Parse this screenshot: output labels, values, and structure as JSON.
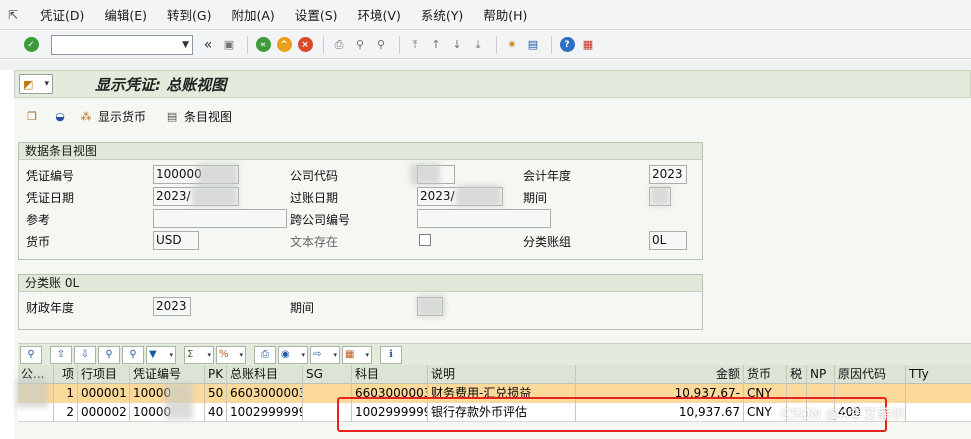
{
  "menu": {
    "items": [
      "凭证(D)",
      "编辑(E)",
      "转到(G)",
      "附加(A)",
      "设置(S)",
      "环境(V)",
      "系统(Y)",
      "帮助(H)"
    ]
  },
  "toolbar": {
    "command_value": ""
  },
  "title": "显示凭证: 总账视图",
  "app_toolbar": {
    "display_currency": "显示货币",
    "item_view": "条目视图"
  },
  "doc_group": {
    "title": "数据条目视图",
    "doc_number_label": "凭证编号",
    "doc_number_value": "100000",
    "company_code_label": "公司代码",
    "company_code_value": "",
    "fiscal_year_label": "会计年度",
    "fiscal_year_value": "2023",
    "doc_date_label": "凭证日期",
    "doc_date_value": "2023/",
    "posting_date_label": "过账日期",
    "posting_date_value": "2023/",
    "period_label": "期间",
    "period_value": "",
    "reference_label": "参考",
    "reference_value": "",
    "cross_company_label": "跨公司编号",
    "cross_company_value": "",
    "currency_label": "货币",
    "currency_value": "USD",
    "text_exists_label": "文本存在",
    "ledger_group_label": "分类账组",
    "ledger_group_value": "0L"
  },
  "ledger_group": {
    "title": "分类账 0L",
    "fiscal_year_label": "财政年度",
    "fiscal_year_value": "2023",
    "period_label": "期间",
    "period_value": ""
  },
  "table": {
    "headers": {
      "company": "公...",
      "item": "项",
      "line_item": "行项目",
      "doc_no": "凭证编号",
      "pk": "PK",
      "gl_account": "总账科目",
      "sg": "SG",
      "account": "科目",
      "text": "说明",
      "amount": "金额",
      "currency": "货币",
      "tax": "税",
      "np": "NP",
      "reason": "原因代码",
      "tty": "TTy"
    },
    "rows": [
      {
        "company": "",
        "item": "1",
        "line_item": "000001",
        "doc_no": "10000",
        "pk": "50",
        "gl_account": "6603000003",
        "sg": "",
        "account": "6603000003",
        "text": "财务费用-汇兑损益",
        "amount": "10,937.67-",
        "currency": "CNY",
        "tax": "",
        "np": "",
        "reason": "",
        "tty": ""
      },
      {
        "company": "",
        "item": "2",
        "line_item": "000002",
        "doc_no": "10000",
        "pk": "40",
        "gl_account": "1002999999",
        "sg": "",
        "account": "1002999999",
        "text": "银行存款外币评估",
        "amount": "10,937.67",
        "currency": "CNY",
        "tax": "",
        "np": "",
        "reason": "400",
        "tty": ""
      }
    ]
  },
  "watermark": "CSDN @A李艾菲尔"
}
